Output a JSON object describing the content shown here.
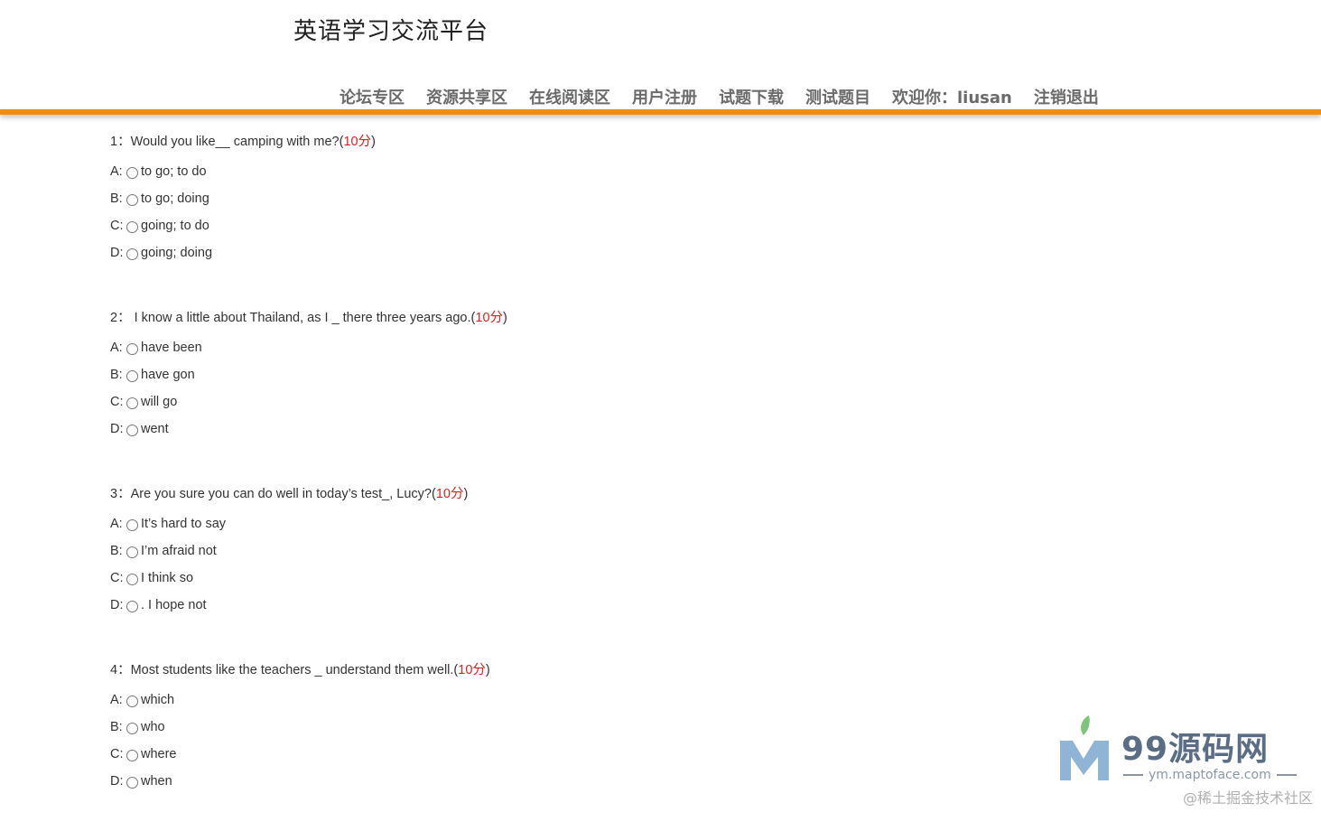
{
  "header": {
    "site_title": "英语学习交流平台",
    "nav": [
      "论坛专区",
      "资源共享区",
      "在线阅读区",
      "用户注册",
      "试题下载",
      "测试题目",
      "欢迎你：liusan",
      "注销退出"
    ]
  },
  "colors": {
    "nav_bar": "#f28c0f",
    "score": "#e02020"
  },
  "questions": [
    {
      "text": "1：Would you like__ camping with me?",
      "score": "10分",
      "options": [
        {
          "letter": "A:",
          "text": "to go; to do"
        },
        {
          "letter": "B:",
          "text": "to go; doing"
        },
        {
          "letter": "C:",
          "text": " going; to do"
        },
        {
          "letter": "D:",
          "text": " going; doing"
        }
      ]
    },
    {
      "text": "2： I know a little about Thailand, as I _ there three years ago.",
      "score": "10分",
      "options": [
        {
          "letter": "A:",
          "text": "have been"
        },
        {
          "letter": "B:",
          "text": "have gon"
        },
        {
          "letter": "C:",
          "text": "will go"
        },
        {
          "letter": "D:",
          "text": "went"
        }
      ]
    },
    {
      "text": "3：Are you sure you can do well in today’s test_, Lucy?",
      "score": "10分",
      "options": [
        {
          "letter": "A:",
          "text": " It’s hard to say"
        },
        {
          "letter": "B:",
          "text": "I’m afraid not"
        },
        {
          "letter": "C:",
          "text": " I think so"
        },
        {
          "letter": "D:",
          "text": ". I hope not"
        }
      ]
    },
    {
      "text": "4：Most students like the teachers _ understand them well.",
      "score": "10分",
      "options": [
        {
          "letter": "A:",
          "text": "which"
        },
        {
          "letter": "B:",
          "text": "who"
        },
        {
          "letter": "C:",
          "text": "where"
        },
        {
          "letter": "D:",
          "text": "when"
        }
      ]
    }
  ],
  "watermark": {
    "brand": "99源码网",
    "url": "ym.maptoface.com",
    "credit": "@稀土掘金技术社区"
  }
}
